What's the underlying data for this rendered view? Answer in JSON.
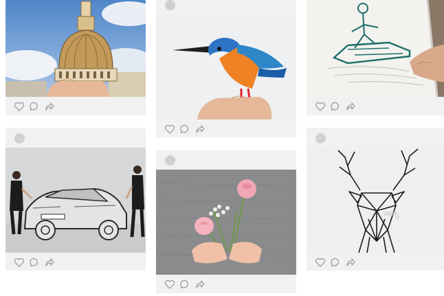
{
  "feed": {
    "posts": [
      {
        "subject": "dome",
        "has_header": false
      },
      {
        "subject": "kingfisher",
        "has_header": true
      },
      {
        "subject": "jet-ski",
        "has_header": false
      },
      {
        "subject": "car",
        "has_header": true
      },
      {
        "subject": "flowers",
        "has_header": true
      },
      {
        "subject": "deer",
        "has_header": true
      }
    ],
    "action_icons": [
      "heart-icon",
      "comment-icon",
      "share-icon"
    ]
  },
  "colors": {
    "card_background": "#f1f1f2",
    "avatar": "#cfd0d2",
    "icon_stroke": "#9b9ea3",
    "page_background": "#ffffff"
  }
}
